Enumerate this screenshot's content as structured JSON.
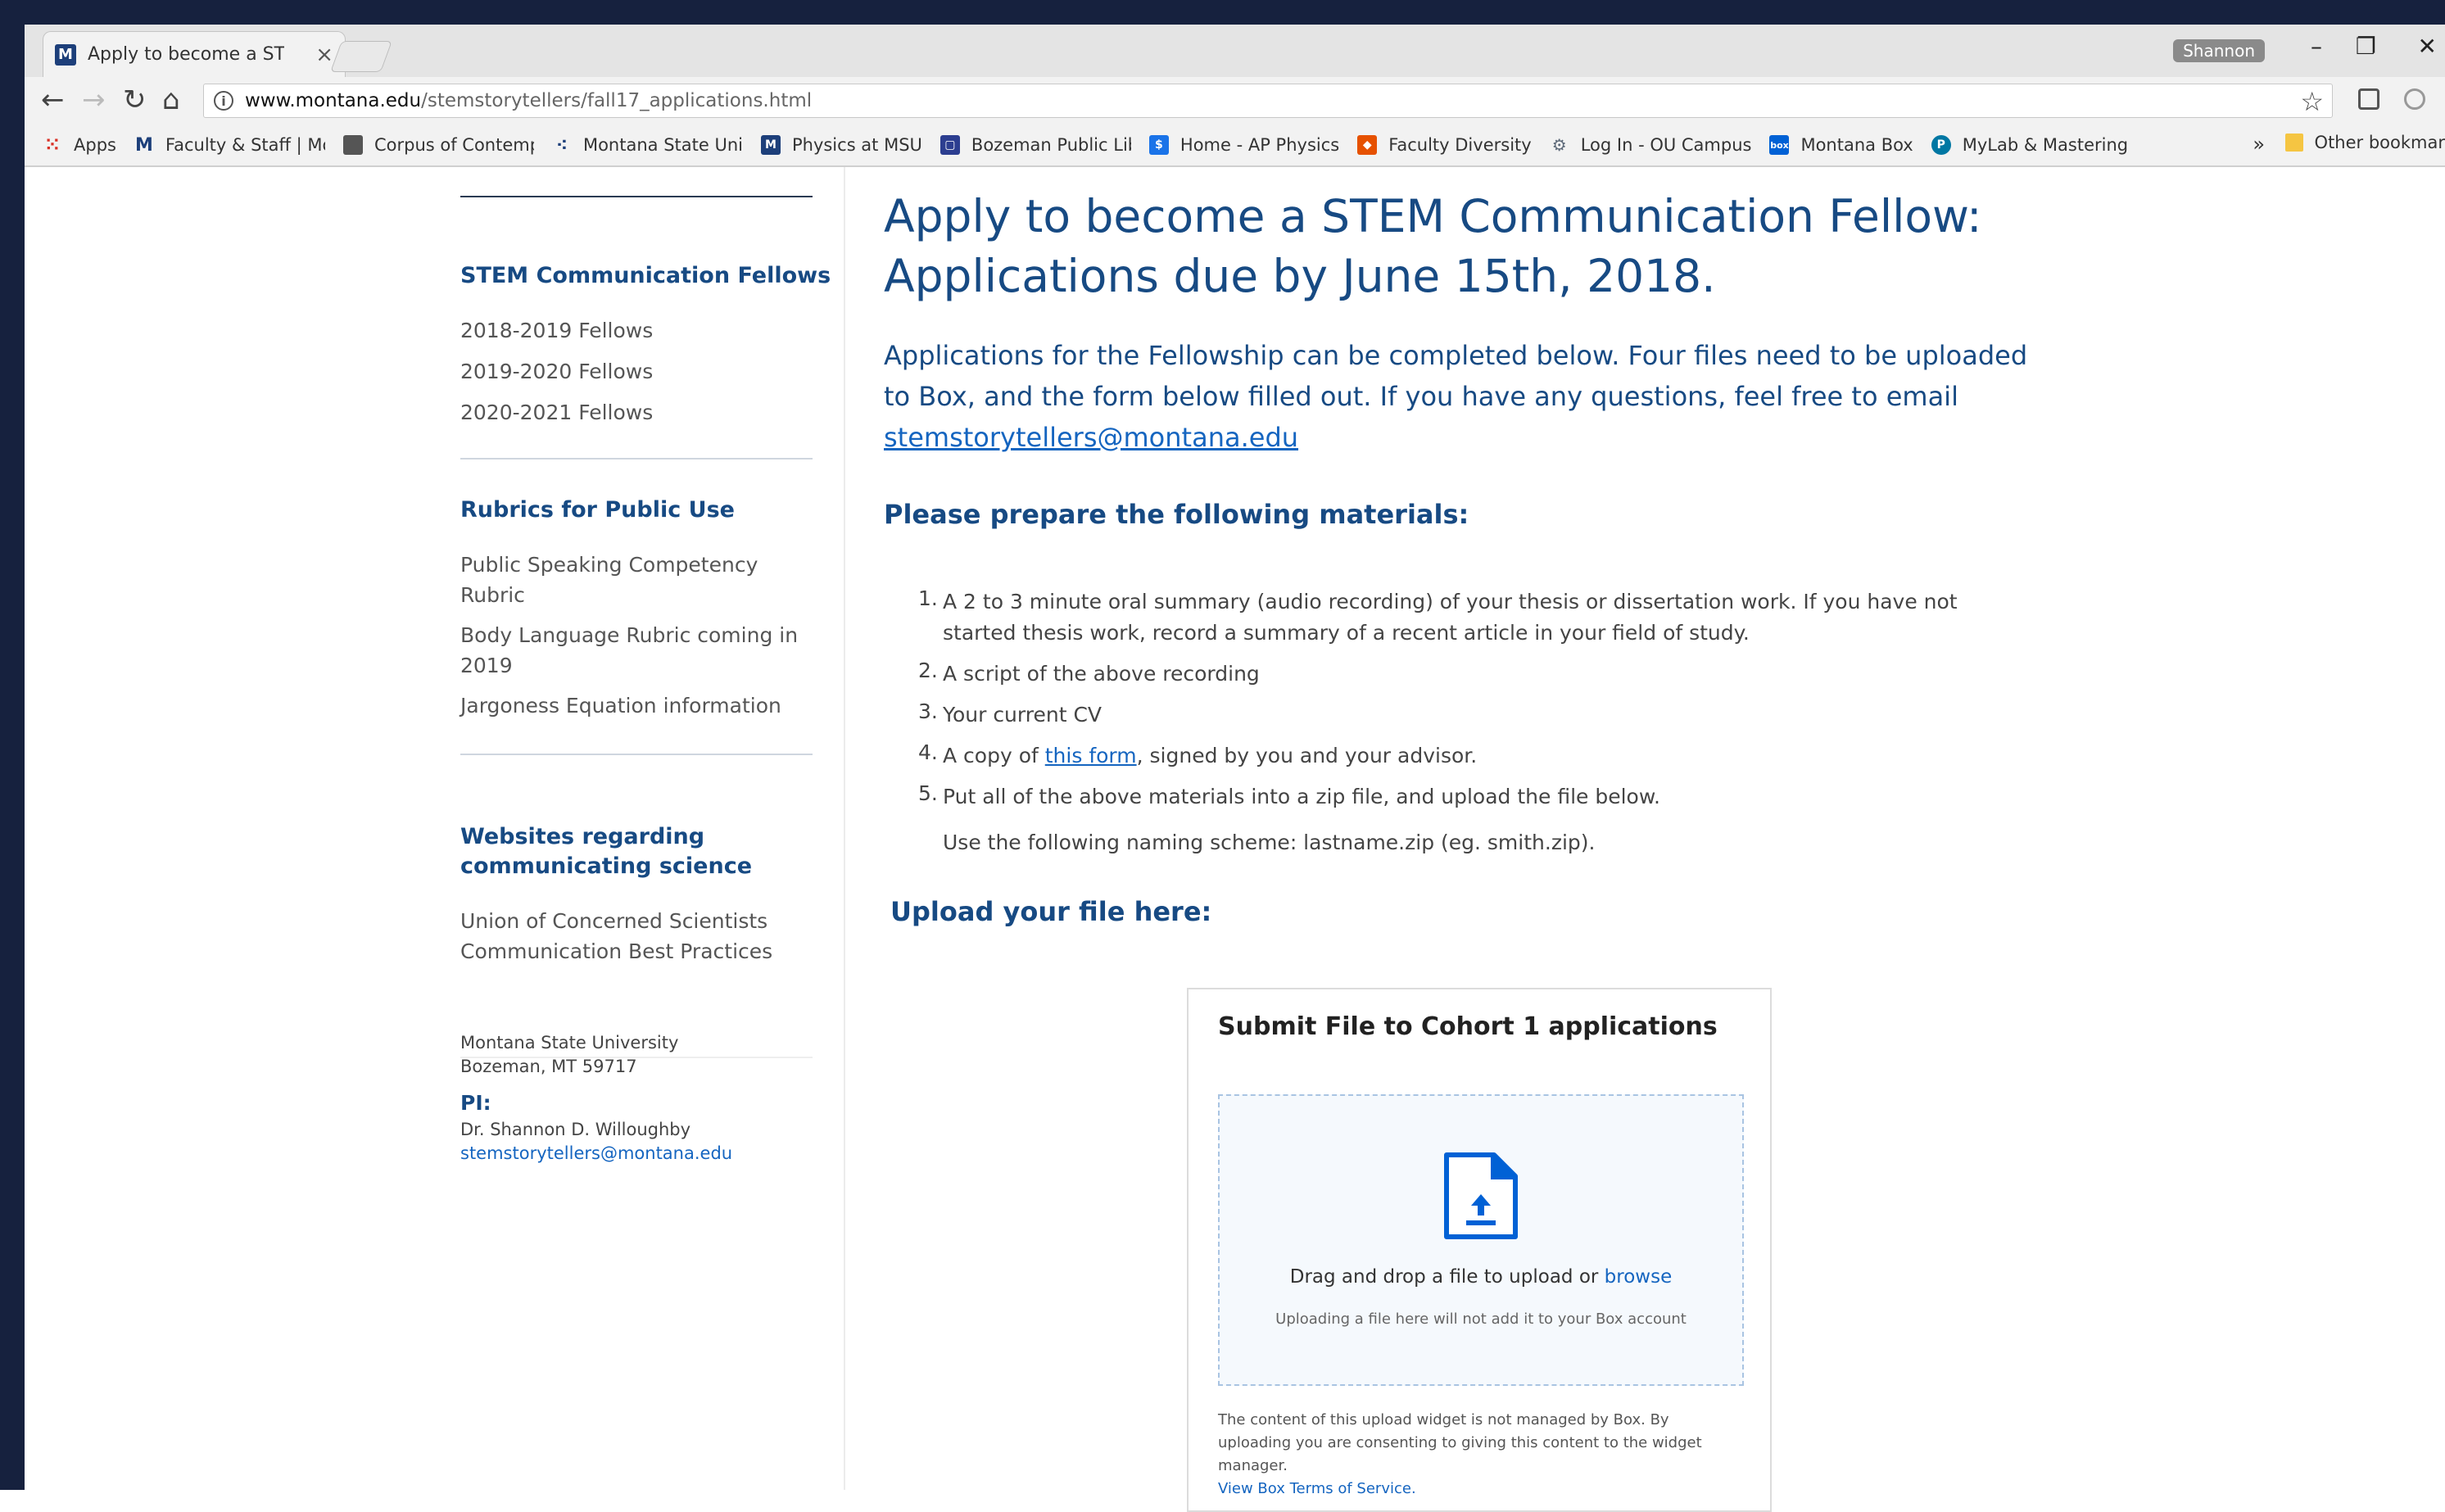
{
  "browser": {
    "tab_title": "Apply to become a STEM",
    "user_name": "Shannon",
    "url_host": "www.montana.edu",
    "url_path": "/stemstorytellers/fall17_applications.html",
    "bookmarks": [
      {
        "label": "Apps",
        "icon": "apps-grid-icon",
        "color": "#d93025"
      },
      {
        "label": "Faculty & Staff | Mon",
        "icon": "msu-logo-icon",
        "color": "#1d3f7a"
      },
      {
        "label": "Corpus of Contemp",
        "icon": "page-icon",
        "color": "#555555"
      },
      {
        "label": "Montana State Univ",
        "icon": "dots-icon",
        "color": "#1d3f7a"
      },
      {
        "label": "Physics at MSU",
        "icon": "msu-logo-icon",
        "color": "#1d3f7a"
      },
      {
        "label": "Bozeman Public Libr",
        "icon": "library-icon",
        "color": "#2c3e90"
      },
      {
        "label": "Home - AP Physics",
        "icon": "ap-physics-icon",
        "color": "#1a73e8"
      },
      {
        "label": "Faculty Diversity",
        "icon": "diversity-icon",
        "color": "#e65100"
      },
      {
        "label": "Log In - OU Campus",
        "icon": "ou-campus-icon",
        "color": "#5f6b7a"
      },
      {
        "label": "Montana Box",
        "icon": "box-icon",
        "color": "#0061d5"
      },
      {
        "label": "MyLab & Mastering",
        "icon": "mylab-icon",
        "color": "#0077a3"
      }
    ],
    "more_label": "»",
    "other_bookmarks": "Other bookmar"
  },
  "sidebar": {
    "fellows_heading": "STEM Communication Fellows",
    "fellows_items": [
      "2018-2019 Fellows",
      "2019-2020 Fellows",
      "2020-2021 Fellows"
    ],
    "rubrics_heading": "Rubrics for Public Use",
    "rubrics_items": [
      "Public Speaking Competency Rubric",
      "Body Language Rubric coming in 2019",
      "Jargoness Equation information"
    ],
    "websites_heading": "Websites regarding communicating science",
    "websites_items": [
      "Union of Concerned Scientists Communication Best Practices"
    ]
  },
  "footer": {
    "org": "Montana State University",
    "city": "Bozeman, MT 59717",
    "pi_label": "PI:",
    "pi_name": "Dr. Shannon D. Willoughby",
    "email": "stemstorytellers@montana.edu"
  },
  "main": {
    "title_line1": "Apply to become a STEM Communication Fellow:",
    "title_line2": "Applications due by June 15th, 2018.",
    "intro_text": "Applications for the Fellowship can be completed below. Four files need to be uploaded to Box, and the form below filled out. If you have any questions, feel free to email",
    "intro_email": "stemstorytellers@montana.edu",
    "materials_heading": "Please prepare the following materials:",
    "list": [
      {
        "num": "1.",
        "text": "A 2 to 3 minute oral summary (audio recording) of your thesis or dissertation work. If you have not started thesis work, record a summary of a recent article in your field of study."
      },
      {
        "num": "2.",
        "text": "A script of the above recording"
      },
      {
        "num": "3.",
        "text": "Your current CV"
      },
      {
        "num": "4.",
        "before": "A copy of ",
        "link": "this form",
        "after": ", signed by you and your advisor."
      },
      {
        "num": "5.",
        "text": "Put all of the above materials into a zip file, and upload the file below."
      }
    ],
    "naming_scheme": "Use the following naming scheme: lastname.zip (eg. smith.zip).",
    "upload_heading": "Upload your file here:"
  },
  "widget": {
    "title": "Submit File to Cohort 1 applications",
    "drop_text": "Drag and drop a file to upload or",
    "browse": "browse",
    "drop_sub": "Uploading a file here will not add it to your Box account",
    "disclaimer": "The content of this upload widget is not managed by Box. By uploading you are consenting to giving this content to the widget manager.",
    "terms_link": "View Box Terms of Service."
  }
}
